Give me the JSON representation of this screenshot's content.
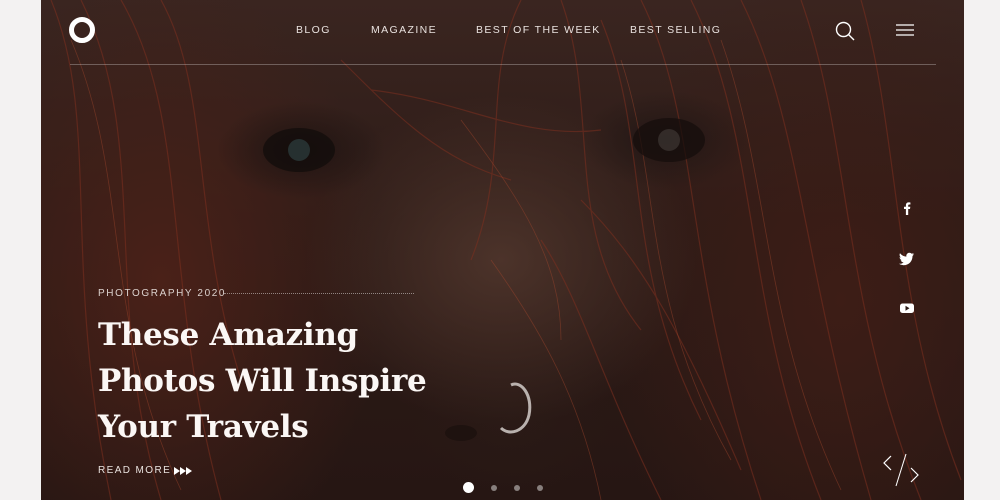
{
  "nav": {
    "items": [
      {
        "label": "BLOG"
      },
      {
        "label": "MAGAZINE"
      },
      {
        "label": "BEST OF THE WEEK"
      },
      {
        "label": "BEST SELLING"
      }
    ]
  },
  "hero": {
    "eyebrow": "PHOTOGRAPHY 2020",
    "headline": "These Amazing Photos Will Inspire Your Travels",
    "read_more": "READ MORE"
  },
  "social": [
    "facebook-icon",
    "twitter-icon",
    "youtube-icon"
  ],
  "carousel": {
    "slides": 4,
    "active": 1
  },
  "colors": {
    "overlay": "#2d1b17",
    "text": "#ffffff",
    "hair": "#7a2e1e"
  }
}
